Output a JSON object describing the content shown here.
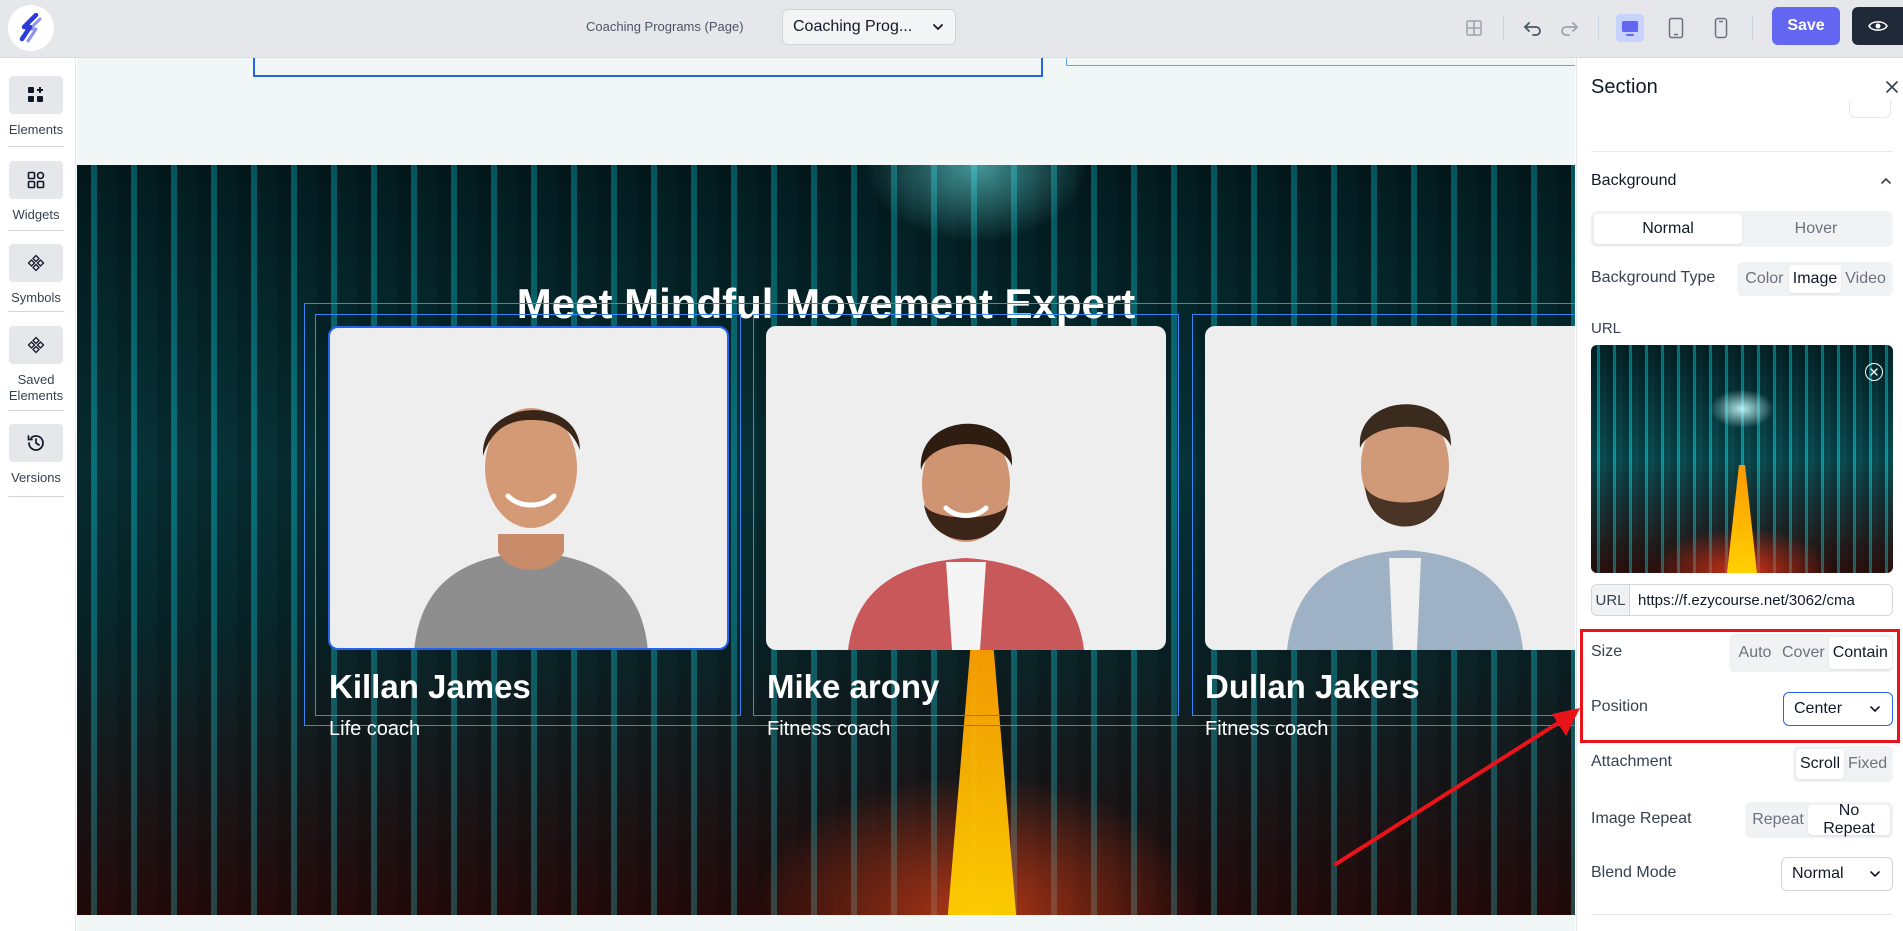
{
  "topbar": {
    "page_label": "Coaching Programs (Page)",
    "page_select_value": "Coaching Prog...",
    "save_label": "Save"
  },
  "sidebar": {
    "items": [
      {
        "label": "Elements",
        "icon": "add-elements-icon"
      },
      {
        "label": "Widgets",
        "icon": "widgets-icon"
      },
      {
        "label": "Symbols",
        "icon": "symbols-icon"
      },
      {
        "label": "Saved Elements",
        "icon": "saved-elements-icon"
      },
      {
        "label": "Versions",
        "icon": "history-icon"
      }
    ]
  },
  "canvas": {
    "title": "Meet Mindful Movement Expert",
    "cards": [
      {
        "name": "Killan James",
        "role": "Life coach"
      },
      {
        "name": "Mike arony",
        "role": "Fitness coach"
      },
      {
        "name": "Dullan Jakers",
        "role": "Fitness coach"
      }
    ]
  },
  "panel": {
    "title": "Section",
    "background_heading": "Background",
    "state_tabs": [
      "Normal",
      "Hover"
    ],
    "state_active": "Normal",
    "background_type_label": "Background Type",
    "background_type_options": [
      "Color",
      "Image",
      "Video"
    ],
    "background_type_active": "Image",
    "url_label": "URL",
    "url_prefix": "URL",
    "url_value": "https://f.ezycourse.net/3062/cma",
    "size_label": "Size",
    "size_options": [
      "Auto",
      "Cover",
      "Contain"
    ],
    "size_active": "Contain",
    "position_label": "Position",
    "position_value": "Center",
    "attachment_label": "Attachment",
    "attachment_options": [
      "Scroll",
      "Fixed"
    ],
    "attachment_active": "Scroll",
    "repeat_label": "Image Repeat",
    "repeat_options": [
      "Repeat",
      "No Repeat"
    ],
    "repeat_active": "No Repeat",
    "blend_label": "Blend Mode",
    "blend_value": "Normal"
  },
  "colors": {
    "accent": "#6366f1",
    "selection": "#2563eb",
    "annotation": "#e8141a"
  }
}
